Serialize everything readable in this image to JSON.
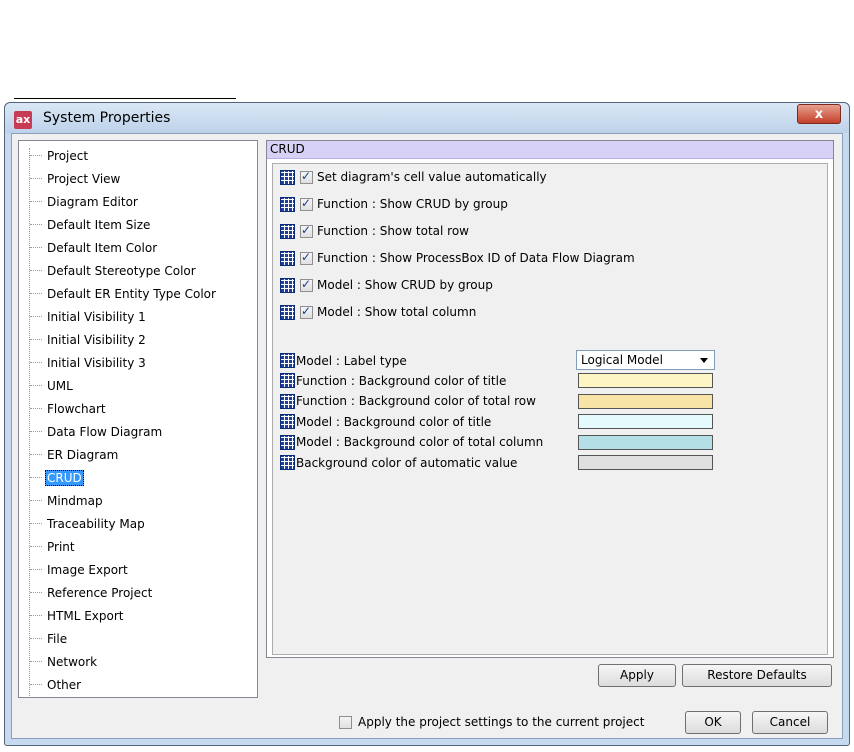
{
  "window": {
    "title": "System Properties",
    "app_icon_text": "ax",
    "close_label": "x"
  },
  "tree": {
    "items": [
      {
        "label": "Project",
        "selected": false
      },
      {
        "label": "Project View",
        "selected": false
      },
      {
        "label": "Diagram Editor",
        "selected": false
      },
      {
        "label": "Default Item Size",
        "selected": false
      },
      {
        "label": "Default Item Color",
        "selected": false
      },
      {
        "label": "Default Stereotype Color",
        "selected": false
      },
      {
        "label": "Default ER Entity Type Color",
        "selected": false
      },
      {
        "label": "Initial Visibility 1",
        "selected": false
      },
      {
        "label": "Initial Visibility 2",
        "selected": false
      },
      {
        "label": "Initial Visibility 3",
        "selected": false
      },
      {
        "label": "UML",
        "selected": false
      },
      {
        "label": "Flowchart",
        "selected": false
      },
      {
        "label": "Data Flow Diagram",
        "selected": false
      },
      {
        "label": "ER Diagram",
        "selected": false
      },
      {
        "label": "CRUD",
        "selected": true
      },
      {
        "label": "Mindmap",
        "selected": false
      },
      {
        "label": "Traceability Map",
        "selected": false
      },
      {
        "label": "Print",
        "selected": false
      },
      {
        "label": "Image Export",
        "selected": false
      },
      {
        "label": "Reference Project",
        "selected": false
      },
      {
        "label": "HTML Export",
        "selected": false
      },
      {
        "label": "File",
        "selected": false
      },
      {
        "label": "Network",
        "selected": false
      },
      {
        "label": "Other",
        "selected": false
      }
    ]
  },
  "panel": {
    "header": "CRUD",
    "checkboxes": [
      {
        "label": "Set diagram's cell value automatically",
        "checked": true
      },
      {
        "label": "Function : Show CRUD by group",
        "checked": true
      },
      {
        "label": "Function : Show total row",
        "checked": true
      },
      {
        "label": "Function : Show ProcessBox ID of Data Flow Diagram",
        "checked": true
      },
      {
        "label": "Model : Show CRUD by group",
        "checked": true
      },
      {
        "label": "Model : Show total column",
        "checked": true
      }
    ],
    "label_type": {
      "label": "Model : Label type",
      "value": "Logical Model"
    },
    "colors": [
      {
        "label": "Function : Background color of title",
        "color": "#fdf5c4"
      },
      {
        "label": "Function : Background color of total row",
        "color": "#f8e3a6"
      },
      {
        "label": "Model : Background color of title",
        "color": "#e4fafd"
      },
      {
        "label": "Model : Background color of total column",
        "color": "#b4dfe6"
      },
      {
        "label": "Background color of automatic value",
        "color": "#e0e0e0"
      }
    ],
    "apply_label": "Apply",
    "restore_label": "Restore Defaults"
  },
  "footer": {
    "apply_project_label": "Apply the project settings to the current project",
    "apply_project_checked": false,
    "ok_label": "OK",
    "cancel_label": "Cancel"
  }
}
